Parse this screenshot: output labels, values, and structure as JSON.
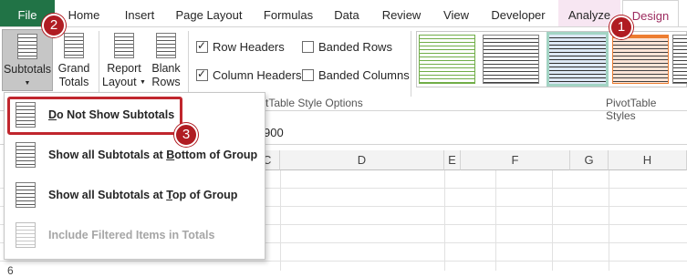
{
  "tabs": [
    {
      "label": "File"
    },
    {
      "label": "Home"
    },
    {
      "label": "Insert"
    },
    {
      "label": "Page Layout"
    },
    {
      "label": "Formulas"
    },
    {
      "label": "Data"
    },
    {
      "label": "Review"
    },
    {
      "label": "View"
    },
    {
      "label": "Developer"
    },
    {
      "label": "Analyze"
    },
    {
      "label": "Design"
    }
  ],
  "ribbon": {
    "subtotals": {
      "line1": "Subtotals",
      "caret": "▼"
    },
    "grand_totals": {
      "line1": "Grand",
      "line2": "Totals",
      "caret": "▼"
    },
    "report_layout": {
      "line1": "Report",
      "line2": "Layout",
      "caret": "▼"
    },
    "blank_rows": {
      "line1": "Blank",
      "line2": "Rows",
      "caret": "▼"
    },
    "options": {
      "row_headers": {
        "label": "Row Headers",
        "checked": true
      },
      "column_headers": {
        "label": "Column Headers",
        "checked": true
      },
      "banded_rows": {
        "label": "Banded Rows",
        "checked": false
      },
      "banded_columns": {
        "label": "Banded Columns",
        "checked": false
      }
    },
    "style_options_label_visible": "tTable Style Options",
    "pivot_styles_label": "PivotTable Styles"
  },
  "formula_bar": {
    "value": "900"
  },
  "columns": [
    "C",
    "D",
    "E",
    "F",
    "G",
    "H"
  ],
  "rows": [
    "6"
  ],
  "menu": {
    "items": [
      {
        "prefix": "",
        "ul": "D",
        "rest": "o Not Show Subtotals",
        "disabled": false
      },
      {
        "prefix": "Show all Subtotals at ",
        "ul": "B",
        "rest": "ottom of Group",
        "disabled": false
      },
      {
        "prefix": "Show all Subtotals at ",
        "ul": "T",
        "rest": "op of Group",
        "disabled": false
      },
      {
        "prefix": "Include Filtered Items in Totals",
        "ul": "",
        "rest": "",
        "disabled": true
      }
    ]
  },
  "callouts": {
    "one": "1",
    "two": "2",
    "three": "3"
  },
  "colors": {
    "file_tab": "#217346",
    "design_tab_text": "#9c2b5f",
    "analyze_tab_bg": "#f7e6f2",
    "callout": "#b01c22",
    "highlight": "#c0262d"
  }
}
